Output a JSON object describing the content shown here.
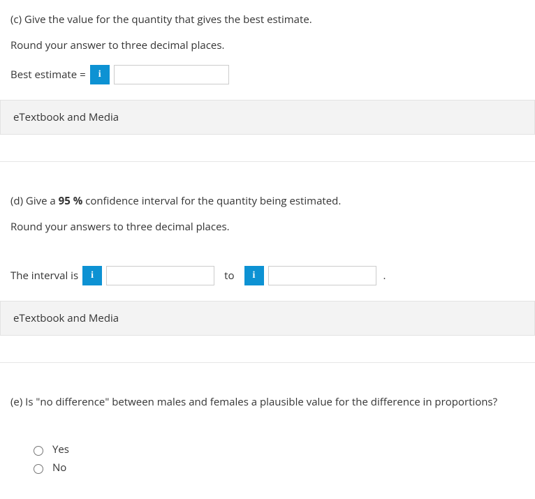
{
  "partC": {
    "prompt": "(c) Give the value for the quantity that gives the best estimate.",
    "sub": "Round your answer to three decimal places.",
    "label": "Best estimate  =",
    "info": "i",
    "value": "",
    "etext": "eTextbook and Media"
  },
  "partD": {
    "prompt_prefix": "(d) Give a ",
    "prompt_bold": "95 %",
    "prompt_suffix": " confidence interval for the quantity being estimated.",
    "sub": "Round your answers to three decimal places.",
    "label": "The interval is",
    "to": "to",
    "period": ".",
    "info": "i",
    "lower": "",
    "upper": "",
    "etext": "eTextbook and Media"
  },
  "partE": {
    "prompt": "(e) Is \"no difference\" between males and females a plausible value for the difference in proportions?",
    "options": {
      "yes": "Yes",
      "no": "No"
    }
  }
}
